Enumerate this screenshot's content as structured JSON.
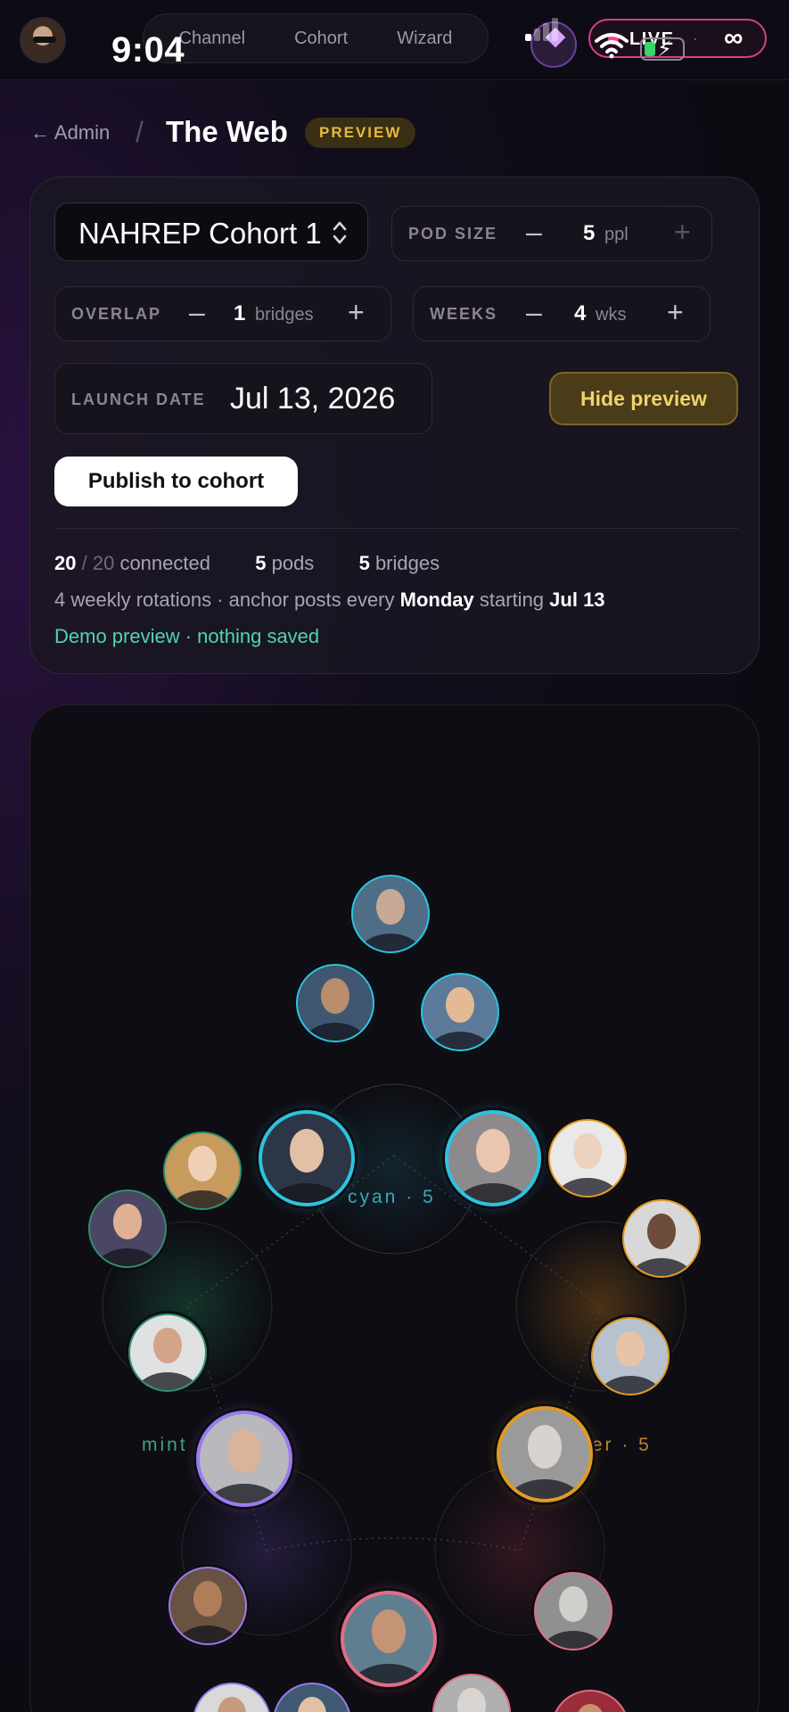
{
  "statusbar": {
    "time": "9:04",
    "live_label": "LIVE",
    "live_separator": "·",
    "live_value": "∞"
  },
  "nav": {
    "tabs": [
      "Channel",
      "Cohort",
      "Wizard"
    ]
  },
  "header": {
    "back_label": "← Admin",
    "separator": "/",
    "title": "The Web",
    "badge": "PREVIEW"
  },
  "settings": {
    "cohort_select": "NAHREP Cohort 1",
    "pod_size": {
      "label": "POD SIZE",
      "minus": "–",
      "value": "5",
      "unit": "ppl",
      "plus": "+"
    },
    "overlap": {
      "label": "OVERLAP",
      "minus": "–",
      "value": "1",
      "unit": "bridges",
      "plus": "+"
    },
    "weeks": {
      "label": "WEEKS",
      "minus": "–",
      "value": "4",
      "unit": "wks",
      "plus": "+"
    },
    "launch_date": {
      "label": "LAUNCH DATE",
      "value": "Jul 13, 2026"
    },
    "hide_preview_label": "Hide preview",
    "publish_label": "Publish to cohort"
  },
  "summary": {
    "connected_count": "20",
    "connected_total": "/ 20",
    "connected_word": "connected",
    "pods_count": "5",
    "pods_word": "pods",
    "bridges_count": "5",
    "bridges_word": "bridges",
    "rotation_text": "4 weekly rotations · anchor posts every",
    "rotation_day": "Monday",
    "rotation_start_word": "starting",
    "rotation_start": "Jul 13",
    "demo_note": "Demo preview · nothing saved"
  },
  "web": {
    "pod_labels": [
      {
        "text": "cyan · 5",
        "color": "#3aa7b8"
      },
      {
        "text": "mint",
        "color": "#3fa27f"
      },
      {
        "text": "amber · 5",
        "color": "#b8852b"
      }
    ],
    "colors": {
      "cyan": "#2bc4e0",
      "mint": "#2f8f6c",
      "amber": "#e29a22",
      "violet": "#9b7bf0",
      "rose": "#e36d86"
    }
  }
}
